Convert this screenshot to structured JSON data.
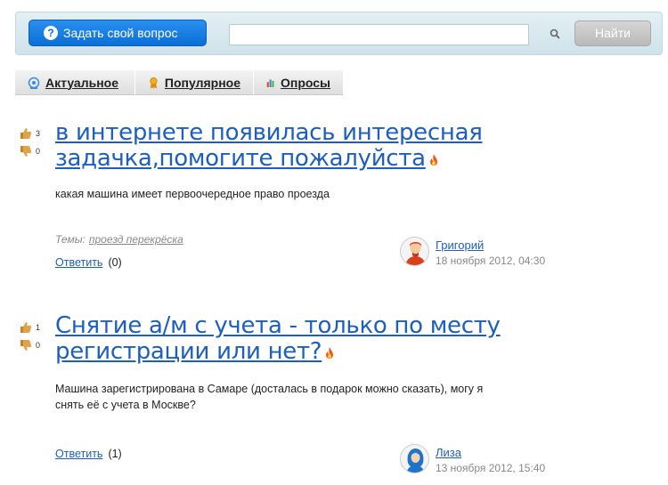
{
  "header": {
    "ask_button": "Задать свой вопрос",
    "search_placeholder": "",
    "find_button": "Найти"
  },
  "tabs": [
    {
      "label": "Актуальное",
      "icon": "target-icon"
    },
    {
      "label": "Популярное",
      "icon": "ribbon-icon"
    },
    {
      "label": "Опросы",
      "icon": "bar-chart-icon"
    }
  ],
  "questions": [
    {
      "likes": "3",
      "dislikes": "0",
      "title_line1": "в интернете появилась интересная",
      "title_line2": "задачка,помогите пожалуйста",
      "text": "какая машина имеет первоочередное право проезда",
      "themes_label": "Темы:",
      "theme_tag": "проезд перекрёска",
      "answer_label": "Ответить",
      "answer_count": "(0)",
      "author": "Григорий",
      "date": "18 ноября 2012, 04:30"
    },
    {
      "likes": "1",
      "dislikes": "0",
      "title_line1": "Снятие а/м с учета - только по месту",
      "title_line2": "регистрации или нет?",
      "text_line1": "Машина зарегистрирована в Самаре (досталась в подарок можно сказать), могу я",
      "text_line2": "снять её с учета в Москве?",
      "answer_label": "Ответить",
      "answer_count": "(1)",
      "author": "Лиза",
      "date": "13 ноября 2012, 15:40"
    }
  ],
  "colors": {
    "link": "#1d5fbf",
    "ask_button": "#0b6fd6",
    "fire": "#f05a14"
  }
}
